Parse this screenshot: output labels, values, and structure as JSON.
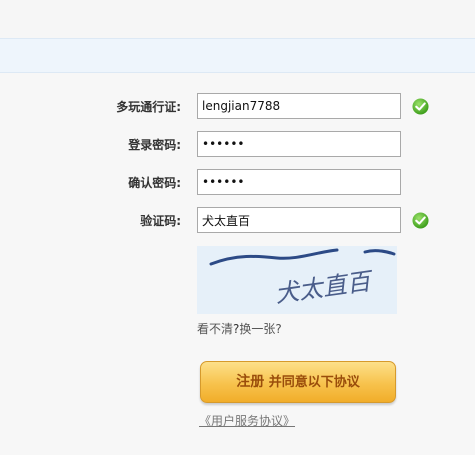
{
  "form": {
    "username": {
      "label": "多玩通行证:",
      "value": "lengjian7788"
    },
    "password": {
      "label": "登录密码:",
      "value": "••••••"
    },
    "confirm_password": {
      "label": "确认密码:",
      "value": "••••••"
    },
    "captcha": {
      "label": "验证码:",
      "value": "犬太直百"
    },
    "captcha_image_text": "犬太直百",
    "refresh_text": "看不清",
    "refresh_q": "?",
    "refresh_link": "换一张?"
  },
  "submit": {
    "main": "注册",
    "rest": " 并同意以下协议"
  },
  "agreement_link": "《用户服务协议》",
  "colors": {
    "check_green": "#4caf27",
    "button_gold": "#f7c24c",
    "band_blue": "#eef5fc"
  }
}
